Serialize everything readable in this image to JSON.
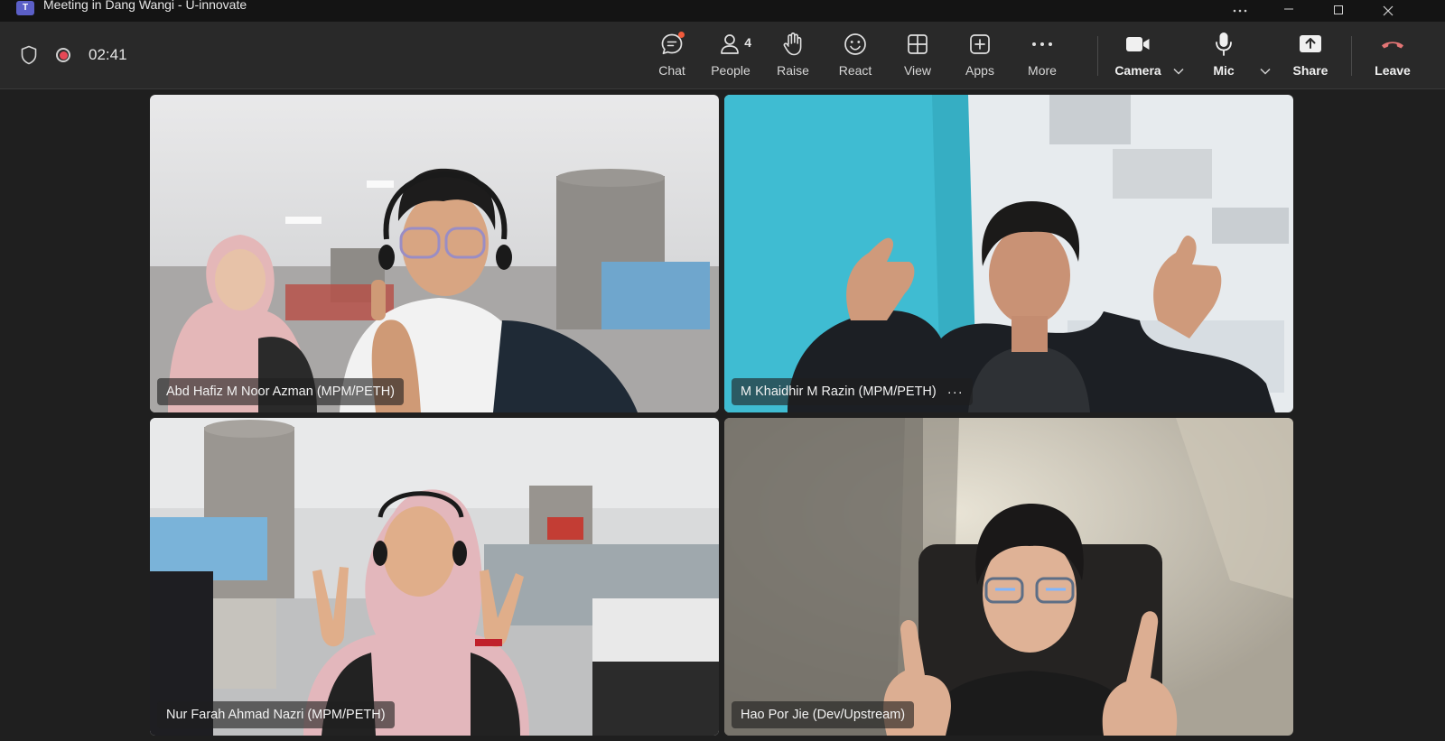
{
  "window": {
    "title": "Meeting in Dang Wangi - U-innovate",
    "app_icon": "teams-icon"
  },
  "meeting": {
    "timer": "02:41",
    "security_icon": "shield-icon",
    "recording_icon": "record-icon"
  },
  "toolbar": {
    "chat": {
      "label": "Chat",
      "icon": "chat-icon",
      "has_notification": true
    },
    "people": {
      "label": "People",
      "count": "4",
      "icon": "people-icon"
    },
    "raise": {
      "label": "Raise",
      "icon": "hand-icon"
    },
    "react": {
      "label": "React",
      "icon": "smiley-icon"
    },
    "view": {
      "label": "View",
      "icon": "grid-icon"
    },
    "apps": {
      "label": "Apps",
      "icon": "plus-square-icon"
    },
    "more": {
      "label": "More",
      "icon": "ellipsis-icon"
    },
    "camera": {
      "label": "Camera",
      "icon": "camera-icon"
    },
    "mic": {
      "label": "Mic",
      "icon": "mic-icon"
    },
    "share": {
      "label": "Share",
      "icon": "share-icon"
    },
    "leave": {
      "label": "Leave",
      "icon": "hangup-icon",
      "color": "#e37575"
    }
  },
  "participants": [
    {
      "name": "Abd Hafiz M Noor Azman (MPM/PETH)",
      "show_more": false
    },
    {
      "name": "M Khaidhir M Razin (MPM/PETH)",
      "show_more": true,
      "more_label": "···"
    },
    {
      "name": "Nur Farah Ahmad Nazri (MPM/PETH)",
      "show_more": false
    },
    {
      "name": "Hao Por Jie (Dev/Upstream)",
      "show_more": false
    }
  ],
  "colors": {
    "background": "#1f1f1f",
    "titlebar": "#141414",
    "toolbar": "#292929",
    "record": "#e74856",
    "teams_brand": "#5b5fc7",
    "notification": "#f15a3b"
  }
}
